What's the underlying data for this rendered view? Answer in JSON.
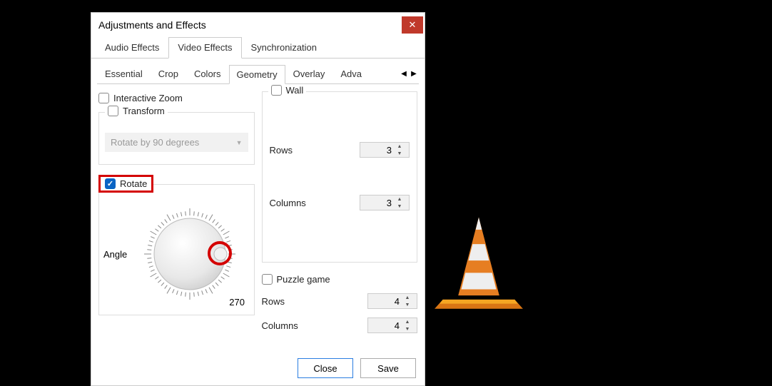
{
  "dialog": {
    "title": "Adjustments and Effects",
    "tabs": {
      "audio": "Audio Effects",
      "video": "Video Effects",
      "sync": "Synchronization"
    },
    "subtabs": {
      "essential": "Essential",
      "crop": "Crop",
      "colors": "Colors",
      "geometry": "Geometry",
      "overlay": "Overlay",
      "advanced": "Adva"
    },
    "interactive_zoom": "Interactive Zoom",
    "transform": {
      "label": "Transform",
      "option": "Rotate by 90 degrees"
    },
    "rotate": {
      "label": "Rotate",
      "angle_label": "Angle",
      "angle_value": "270"
    },
    "wall": {
      "label": "Wall",
      "rows_label": "Rows",
      "rows_value": "3",
      "cols_label": "Columns",
      "cols_value": "3"
    },
    "puzzle": {
      "label": "Puzzle game",
      "rows_label": "Rows",
      "rows_value": "4",
      "cols_label": "Columns",
      "cols_value": "4"
    },
    "buttons": {
      "close": "Close",
      "save": "Save"
    }
  }
}
